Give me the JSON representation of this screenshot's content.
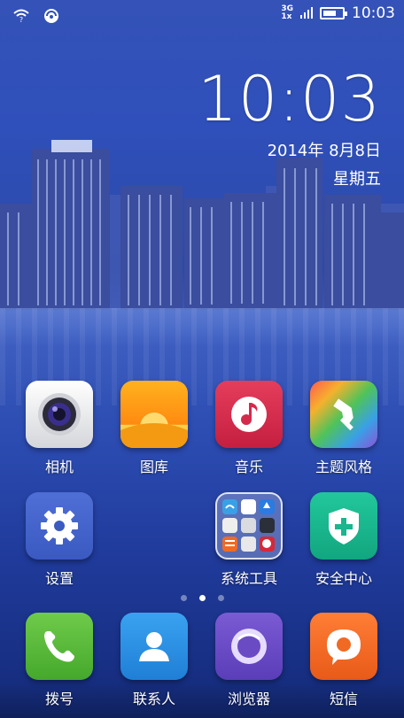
{
  "status_bar": {
    "left_icons": [
      "wifi-question-icon",
      "sync-icon"
    ],
    "network_top": "3G",
    "network_bottom": "1x",
    "battery_level": 0.7,
    "time": "10:03"
  },
  "clock_widget": {
    "time": "10:03",
    "date": "2014年 8月8日",
    "weekday": "星期五"
  },
  "home_apps": [
    {
      "label": "相机",
      "icon": "camera-icon"
    },
    {
      "label": "图库",
      "icon": "gallery-icon"
    },
    {
      "label": "音乐",
      "icon": "music-icon"
    },
    {
      "label": "主题风格",
      "icon": "theme-icon"
    },
    {
      "label": "设置",
      "icon": "settings-icon"
    },
    {
      "label": "系统工具",
      "icon": "system-tools-folder-icon"
    },
    {
      "label": "安全中心",
      "icon": "security-center-icon"
    }
  ],
  "page_indicator": {
    "pages": 3,
    "current": 2
  },
  "dock_apps": [
    {
      "label": "拨号",
      "icon": "phone-icon"
    },
    {
      "label": "联系人",
      "icon": "contacts-icon"
    },
    {
      "label": "浏览器",
      "icon": "browser-icon"
    },
    {
      "label": "短信",
      "icon": "messages-icon"
    }
  ],
  "colors": {
    "wallpaper": "#2f4fba",
    "music": "#d42a4c",
    "security": "#1bb58f",
    "phone": "#56b83a",
    "contacts": "#2a8fe0",
    "browser": "#6a4bc4",
    "messages": "#f06a24"
  }
}
